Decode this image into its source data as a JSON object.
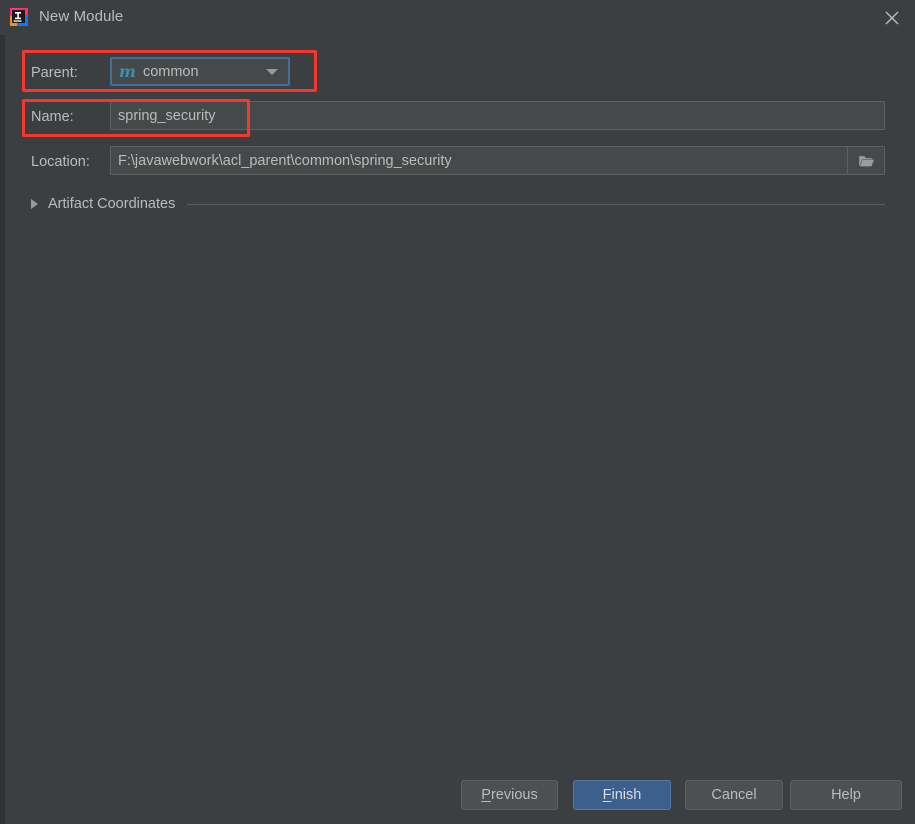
{
  "window": {
    "title": "New Module",
    "app_icon": "intellij-idea-icon",
    "close_label": "×"
  },
  "form": {
    "parent": {
      "label": "Parent:",
      "value": "common",
      "icon": "maven-module-icon",
      "icon_glyph": "m",
      "arrow_icon": "chevron-down-icon"
    },
    "name": {
      "label": "Name:",
      "value": "spring_security",
      "placeholder": ""
    },
    "location": {
      "label": "Location:",
      "value": "F:\\javawebwork\\acl_parent\\common\\spring_security",
      "placeholder": "",
      "browse_icon": "folder-icon"
    },
    "artifact_coordinates": {
      "label": "Artifact Coordinates",
      "expander_icon": "triangle-right-icon",
      "expanded": false
    }
  },
  "buttons": {
    "previous": {
      "label": "Previous",
      "mnemonic": "P"
    },
    "finish": {
      "label": "Finish",
      "mnemonic": "F",
      "primary": true
    },
    "cancel": {
      "label": "Cancel"
    },
    "help": {
      "label": "Help"
    }
  },
  "annotations": [
    {
      "name": "parent-row-highlight",
      "color": "#f4382e"
    },
    {
      "name": "name-row-highlight",
      "color": "#f4382e"
    }
  ],
  "colors": {
    "background": "#3c3f41",
    "field_background": "#45494a",
    "text": "#bbbbbb",
    "focus_border": "#466d94",
    "primary_button": "#3c5f8c",
    "maven_icon": "#3d8fb0",
    "annotation": "#f4382e"
  }
}
